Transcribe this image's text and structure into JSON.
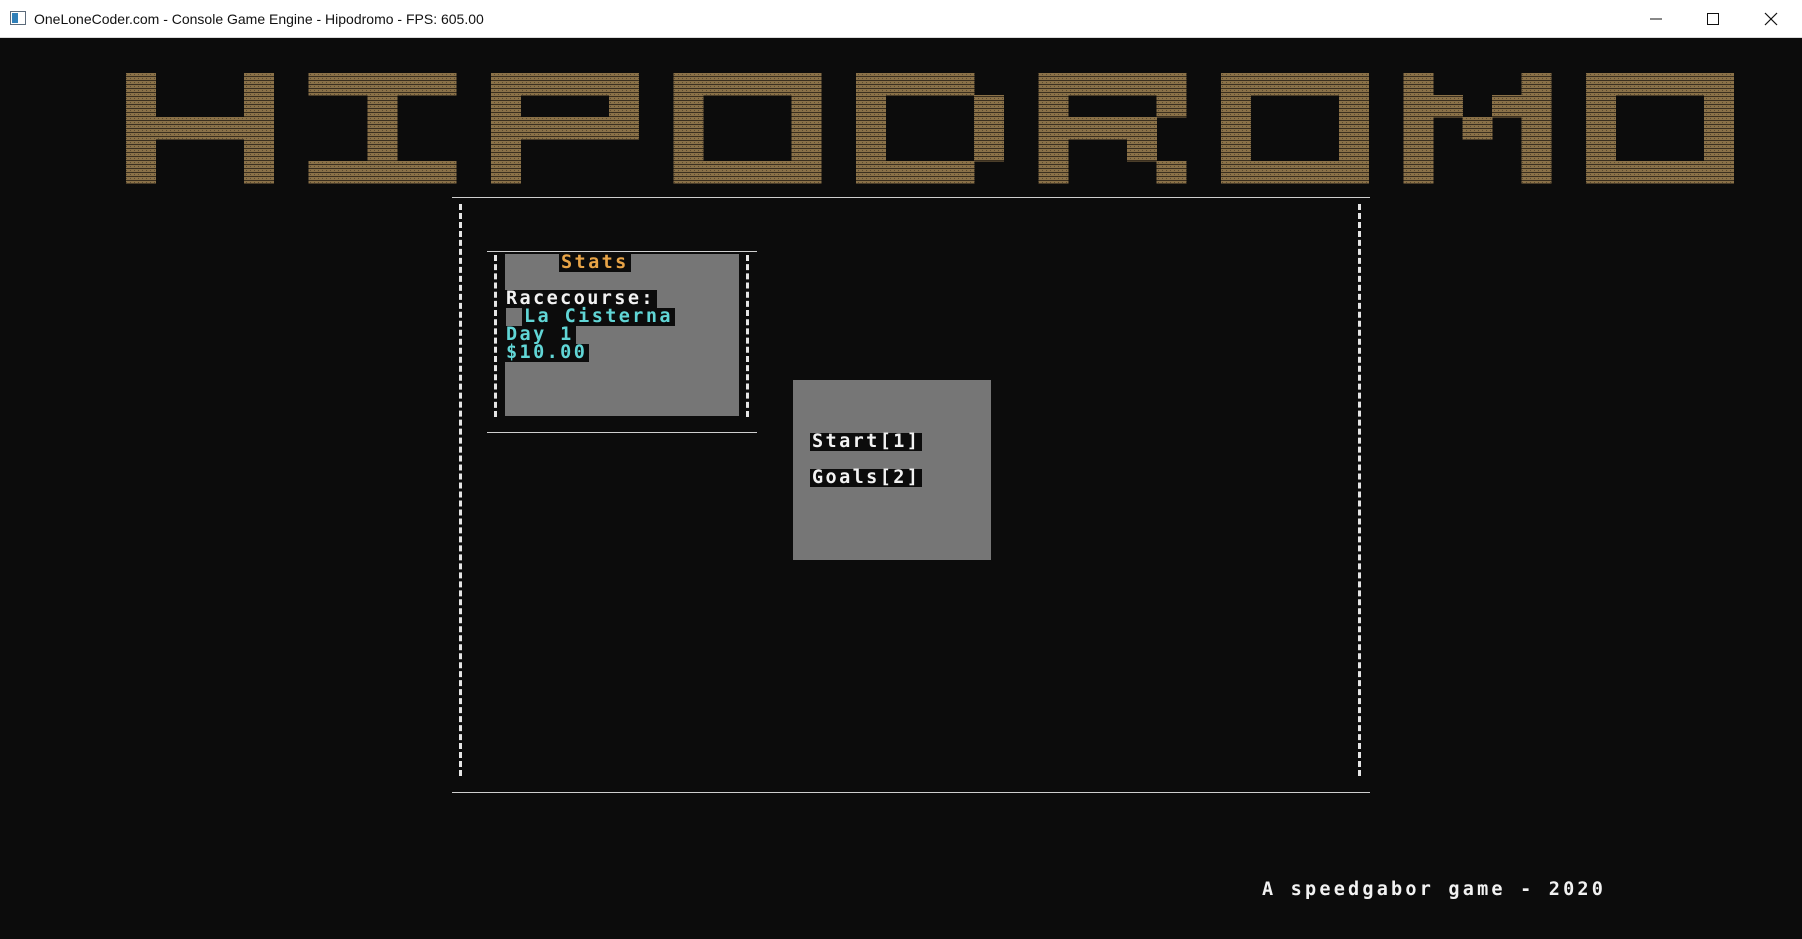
{
  "window": {
    "title": "OneLoneCoder.com - Console Game Engine - Hipodromo - FPS: 605.00",
    "icon": "console-window-icon",
    "controls": [
      "minimize-icon",
      "maximize-icon",
      "close-icon"
    ]
  },
  "logo": {
    "text": "HIPODROMO",
    "color": "#8a7148"
  },
  "stats": {
    "title": "Stats",
    "racecourse_label": "Racecourse:",
    "racecourse_value": "La Cisterna",
    "day": "Day 1",
    "money": "$10.00"
  },
  "menu": {
    "items": [
      {
        "label": "Start[1]"
      },
      {
        "label": "Goals[2]"
      }
    ]
  },
  "footer": {
    "credit": "A speedgabor game - 2020"
  },
  "colors": {
    "background": "#0c0c0c",
    "panel": "#767676",
    "title_accent": "#e8a447",
    "value_accent": "#61d6d6",
    "text": "#f2f2f2"
  }
}
